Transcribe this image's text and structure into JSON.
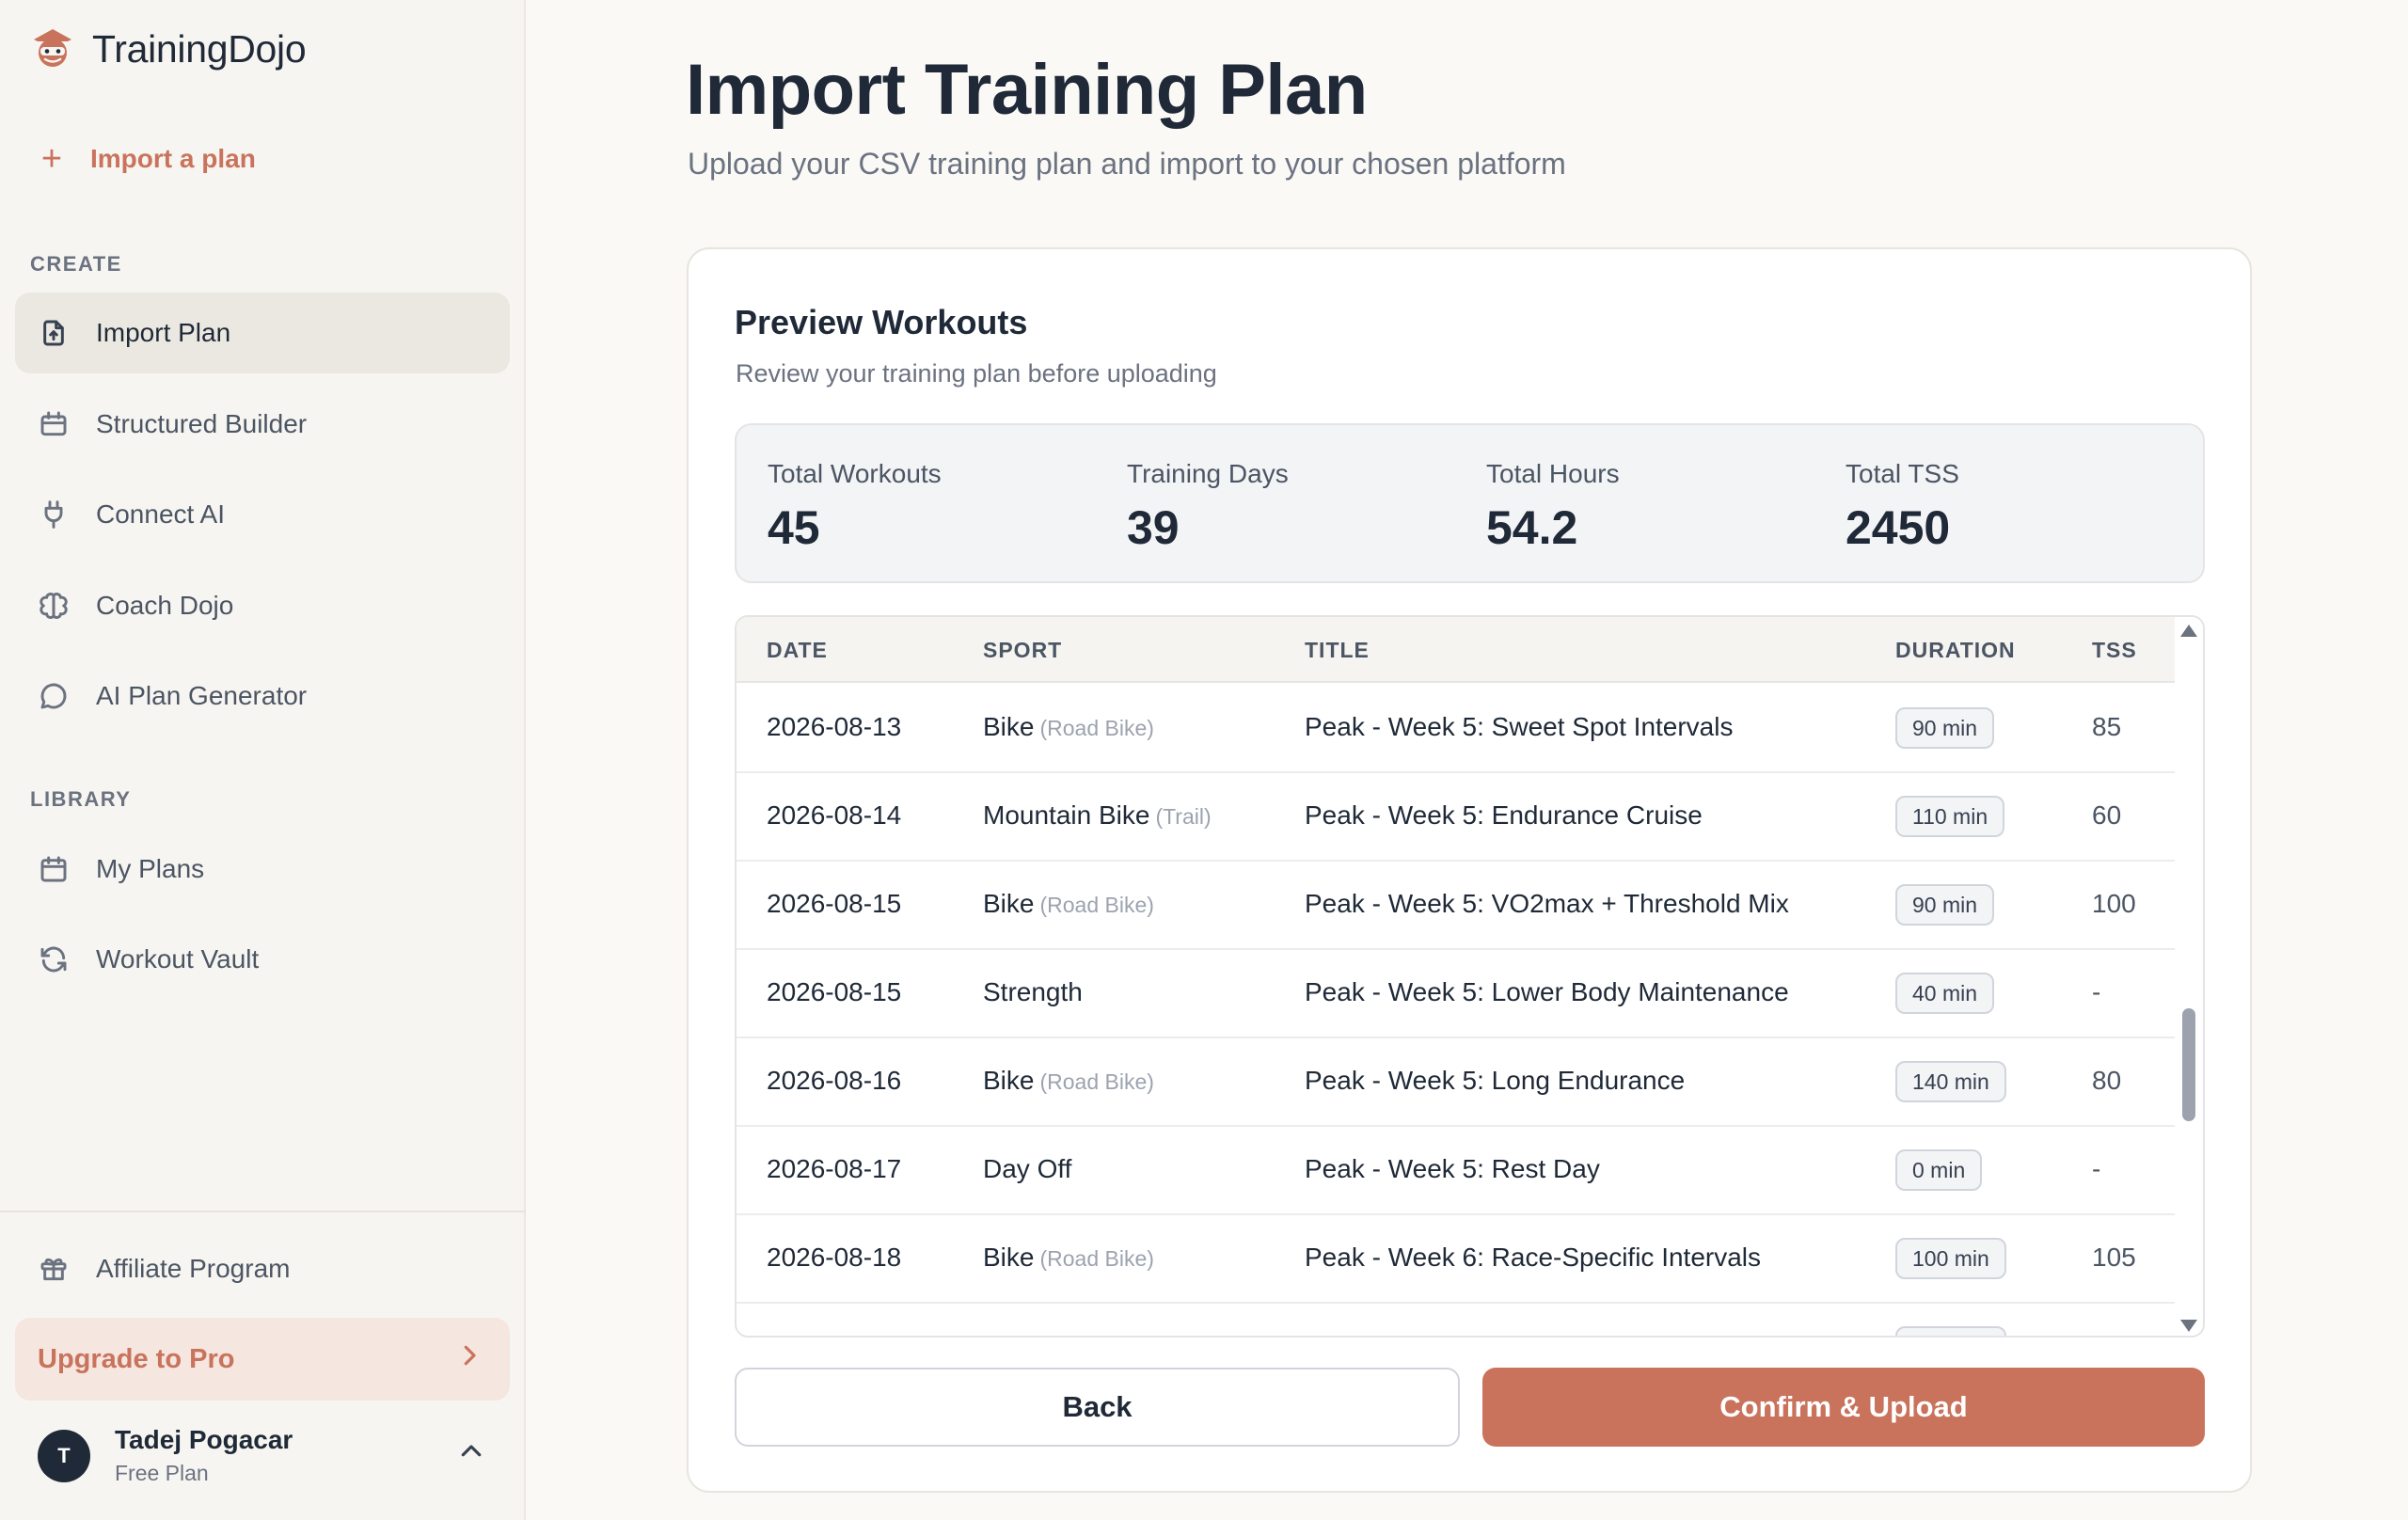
{
  "app": {
    "name": "TrainingDojo",
    "logo_icon": "ninja-mascot-icon",
    "accent": "#c9735c"
  },
  "sidebar": {
    "import_link": "Import a plan",
    "sections": {
      "create": "CREATE",
      "library": "LIBRARY"
    },
    "create_items": [
      {
        "label": "Import Plan",
        "icon": "file-upload-icon",
        "active": true
      },
      {
        "label": "Structured Builder",
        "icon": "calendar-icon"
      },
      {
        "label": "Connect AI",
        "icon": "plug-icon"
      },
      {
        "label": "Coach Dojo",
        "icon": "brain-icon"
      },
      {
        "label": "AI Plan Generator",
        "icon": "chat-bubble-icon"
      }
    ],
    "library_items": [
      {
        "label": "My Plans",
        "icon": "calendar-icon"
      },
      {
        "label": "Workout Vault",
        "icon": "refresh-icon"
      }
    ],
    "affiliate": {
      "label": "Affiliate Program",
      "icon": "gift-icon"
    },
    "upgrade": {
      "label": "Upgrade to Pro"
    },
    "user": {
      "initial": "T",
      "name": "Tadej Pogacar",
      "plan": "Free Plan"
    }
  },
  "main": {
    "title": "Import Training Plan",
    "subtitle": "Upload your CSV training plan and import to your chosen platform",
    "card": {
      "title": "Preview Workouts",
      "subtitle": "Review your training plan before uploading",
      "stats": [
        {
          "label": "Total Workouts",
          "value": "45"
        },
        {
          "label": "Training Days",
          "value": "39"
        },
        {
          "label": "Total Hours",
          "value": "54.2"
        },
        {
          "label": "Total TSS",
          "value": "2450"
        }
      ],
      "table": {
        "headers": {
          "date": "DATE",
          "sport": "SPORT",
          "title": "TITLE",
          "duration": "DURATION",
          "tss": "TSS"
        },
        "rows": [
          {
            "date": "2026-08-13",
            "sport": "Bike",
            "subtype": "(Road Bike)",
            "title": "Peak - Week 5: Sweet Spot Intervals",
            "duration": "90 min",
            "tss": "85"
          },
          {
            "date": "2026-08-14",
            "sport": "Mountain Bike",
            "subtype": "(Trail)",
            "title": "Peak - Week 5: Endurance Cruise",
            "duration": "110 min",
            "tss": "60"
          },
          {
            "date": "2026-08-15",
            "sport": "Bike",
            "subtype": "(Road Bike)",
            "title": "Peak - Week 5: VO2max + Threshold Mix",
            "duration": "90 min",
            "tss": "100"
          },
          {
            "date": "2026-08-15",
            "sport": "Strength",
            "subtype": "",
            "title": "Peak - Week 5: Lower Body Maintenance",
            "duration": "40 min",
            "tss": "-"
          },
          {
            "date": "2026-08-16",
            "sport": "Bike",
            "subtype": "(Road Bike)",
            "title": "Peak - Week 5: Long Endurance",
            "duration": "140 min",
            "tss": "80"
          },
          {
            "date": "2026-08-17",
            "sport": "Day Off",
            "subtype": "",
            "title": "Peak - Week 5: Rest Day",
            "duration": "0 min",
            "tss": "-"
          },
          {
            "date": "2026-08-18",
            "sport": "Bike",
            "subtype": "(Road Bike)",
            "title": "Peak - Week 6: Race-Specific Intervals",
            "duration": "100 min",
            "tss": "105"
          }
        ]
      },
      "buttons": {
        "back": "Back",
        "confirm": "Confirm & Upload"
      }
    }
  }
}
